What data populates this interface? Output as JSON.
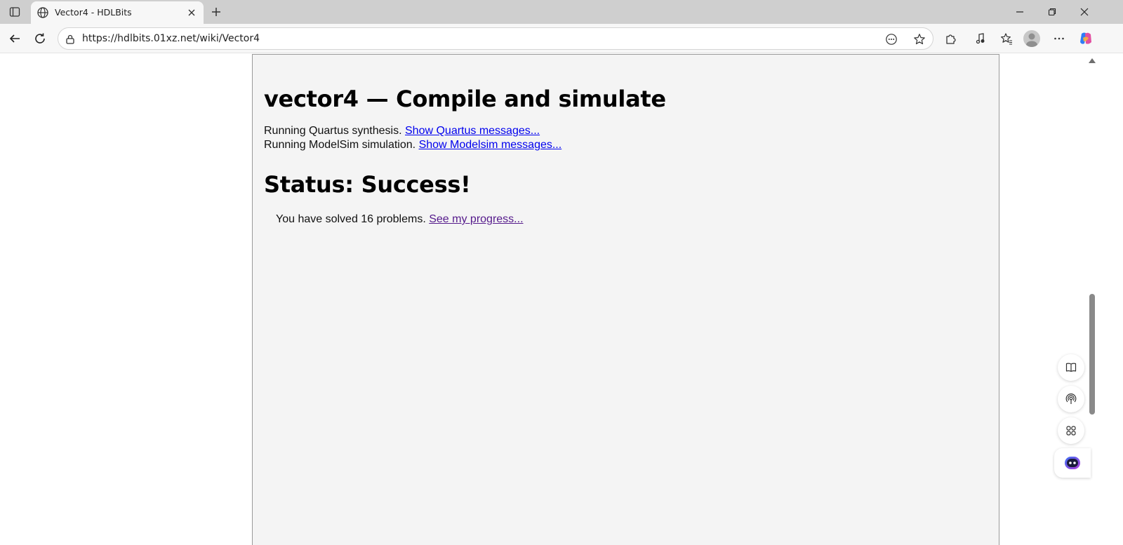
{
  "browser": {
    "tab": {
      "title": "Vector4 - HDLBits",
      "favicon": "globe-icon"
    },
    "address_bar": {
      "url": "https://hdlbits.01xz.net/wiki/Vector4"
    },
    "icons": {
      "tab_actions": "tab-actions-icon",
      "new_tab": "plus-icon",
      "back": "back-arrow-icon",
      "refresh": "refresh-icon",
      "site_info": "lock-icon",
      "reading_mode": "more-circle-icon",
      "favorite": "star-icon",
      "extensions": "puzzle-icon",
      "media": "music-icon",
      "favorites_bar": "favorites-icon",
      "profile": "profile-avatar-icon",
      "more": "ellipsis-icon",
      "copilot": "copilot-icon"
    }
  },
  "page": {
    "heading": "vector4 — Compile and simulate",
    "quartus_text": "Running Quartus synthesis.",
    "quartus_link": "Show Quartus messages...",
    "modelsim_text": "Running ModelSim simulation.",
    "modelsim_link": "Show Modelsim messages...",
    "status_heading": "Status: Success!",
    "progress_text": "You have solved 16 problems.",
    "progress_link": "See my progress..."
  },
  "sidebar": {
    "items": [
      "book-icon",
      "podcast-icon",
      "apps-icon",
      "copilot-face-icon"
    ]
  },
  "colors": {
    "link": "#0000ee",
    "visited_link": "#551a8b",
    "panel_bg": "#f4f4f4"
  }
}
